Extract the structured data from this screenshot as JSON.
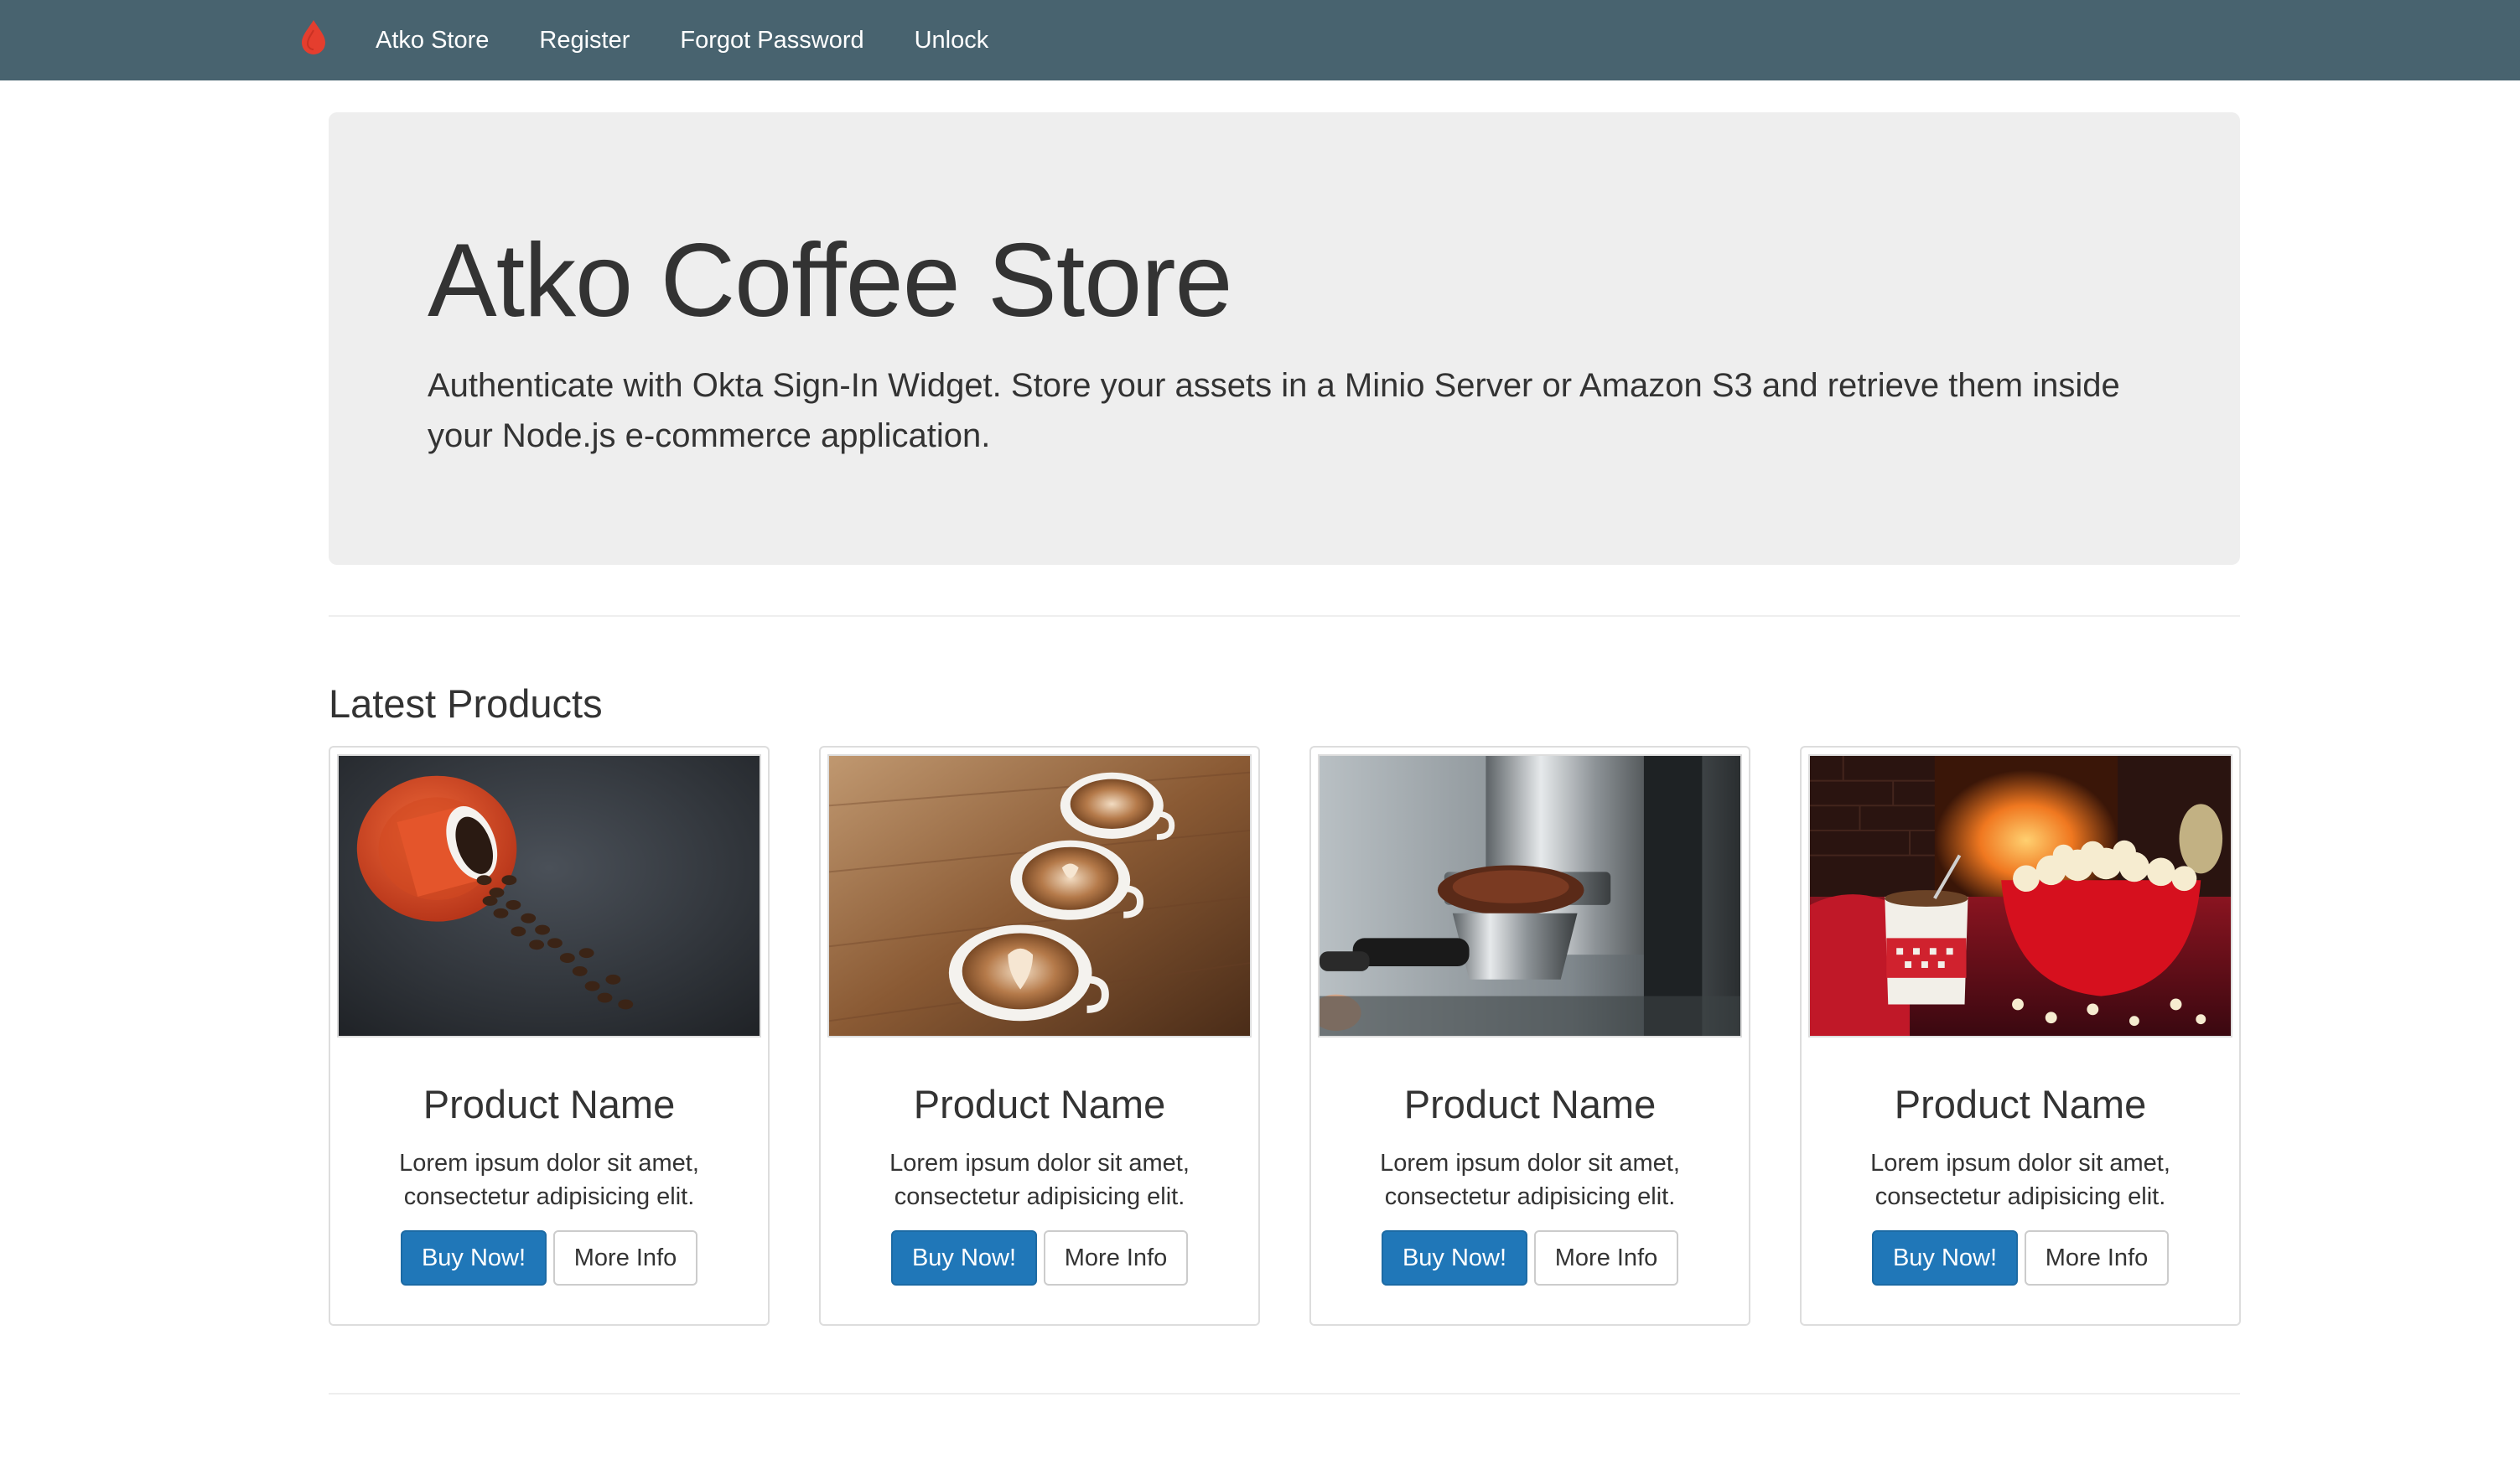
{
  "nav": {
    "brand_icon": "drop-icon",
    "brand_color": "#e53e2e",
    "background": "#48636f",
    "links": [
      "Atko Store",
      "Register",
      "Forgot Password",
      "Unlock"
    ]
  },
  "hero": {
    "title": "Atko Coffee Store",
    "lead": "Authenticate with Okta Sign-In Widget. Store your assets in a Minio Server or Amazon S3 and retrieve them inside your Node.js e-commerce application."
  },
  "products_section": {
    "title": "Latest Products"
  },
  "products": [
    {
      "image": "spilled-coffee-beans-cup-photo",
      "name": "Product Name",
      "description": "Lorem ipsum dolor sit amet, consectetur adipisicing elit.",
      "buy_label": "Buy Now!",
      "info_label": "More Info"
    },
    {
      "image": "latte-art-cups-photo",
      "name": "Product Name",
      "description": "Lorem ipsum dolor sit amet, consectetur adipisicing elit.",
      "buy_label": "Buy Now!",
      "info_label": "More Info"
    },
    {
      "image": "espresso-machine-portafilter-photo",
      "name": "Product Name",
      "description": "Lorem ipsum dolor sit amet, consectetur adipisicing elit.",
      "buy_label": "Buy Now!",
      "info_label": "More Info"
    },
    {
      "image": "popcorn-bowl-fireplace-photo",
      "name": "Product Name",
      "description": "Lorem ipsum dolor sit amet, consectetur adipisicing elit.",
      "buy_label": "Buy Now!",
      "info_label": "More Info"
    }
  ],
  "colors": {
    "primary_button": "#2077b8",
    "jumbotron_bg": "#eeeeee"
  }
}
